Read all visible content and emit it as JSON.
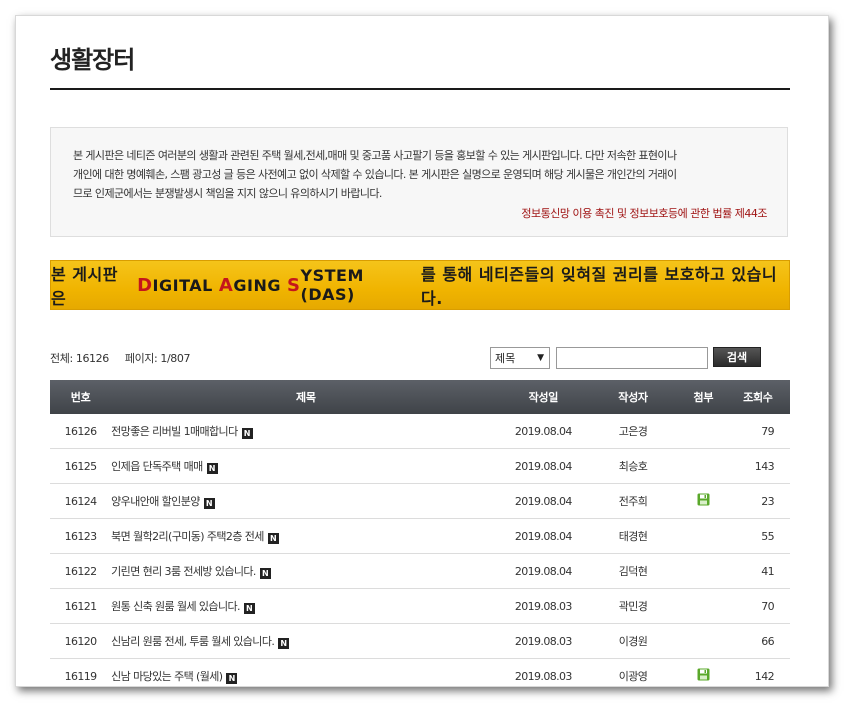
{
  "page": {
    "title": "생활장터"
  },
  "notice": {
    "line1": "본 게시판은 네티즌 여러분의 생활과 관련된 주택 월세,전세,매매 및 중고품 사고팔기 등을 홍보할 수 있는 게시판입니다. 다만 저속한 표현이나",
    "line2": "개인에 대한 명예훼손, 스팸 광고성 글 등은 사전예고 없이 삭제할 수 있습니다. 본 게시판은 실명으로 운영되며 해당 게시물은 개인간의 거래이",
    "line3": "므로 인제군에서는 분쟁발생시 책임을 지지 않으니 유의하시기 바랍니다.",
    "law_link": "정보통신망 이용 촉진 및 정보보호등에 관한 법률 제44조"
  },
  "das_banner": {
    "prefix": "본 게시판은 ",
    "d": "D",
    "d_rest": "IGITAL ",
    "a": "A",
    "a_rest": "GING ",
    "s": "S",
    "s_rest": "YSTEM (DAS)",
    "suffix": " 를 통해 네티즌들의 잊혀질 권리를 보호하고 있습니다."
  },
  "info": {
    "total_label": "전체: 16126",
    "page_label": "페이지: 1/807"
  },
  "search": {
    "select_value": "제목",
    "button_label": "검색",
    "input_value": ""
  },
  "table": {
    "headers": {
      "no": "번호",
      "title": "제목",
      "date": "작성일",
      "author": "작성자",
      "file": "첨부",
      "views": "조회수"
    },
    "new_badge": "N",
    "rows": [
      {
        "no": "16126",
        "title": "전망좋은 리버빌 1매매합니다",
        "date": "2019.08.04",
        "author": "고은경",
        "file": false,
        "views": "79"
      },
      {
        "no": "16125",
        "title": "인제읍 단독주택 매매",
        "date": "2019.08.04",
        "author": "최승호",
        "file": false,
        "views": "143"
      },
      {
        "no": "16124",
        "title": "양우내안애 할인분양",
        "date": "2019.08.04",
        "author": "전주희",
        "file": true,
        "views": "23"
      },
      {
        "no": "16123",
        "title": "북면 월학2리(구미동) 주택2층 전세",
        "date": "2019.08.04",
        "author": "태경현",
        "file": false,
        "views": "55"
      },
      {
        "no": "16122",
        "title": "기린면 현리 3룸 전세방 있습니다.",
        "date": "2019.08.04",
        "author": "김덕현",
        "file": false,
        "views": "41"
      },
      {
        "no": "16121",
        "title": "원통 신축 원룸 월세 있습니다.",
        "date": "2019.08.03",
        "author": "곽민경",
        "file": false,
        "views": "70"
      },
      {
        "no": "16120",
        "title": "신남리 원룸 전세, 투룸 월세 있습니다.",
        "date": "2019.08.03",
        "author": "이경원",
        "file": false,
        "views": "66"
      },
      {
        "no": "16119",
        "title": "신남 마당있는 주택 (월세)",
        "date": "2019.08.03",
        "author": "이광영",
        "file": true,
        "views": "142"
      }
    ]
  },
  "colors": {
    "header_bg": "#4a4e54",
    "banner_yellow": "#f0b400",
    "law_red": "#a01515",
    "file_icon_green": "#5aa82a"
  }
}
